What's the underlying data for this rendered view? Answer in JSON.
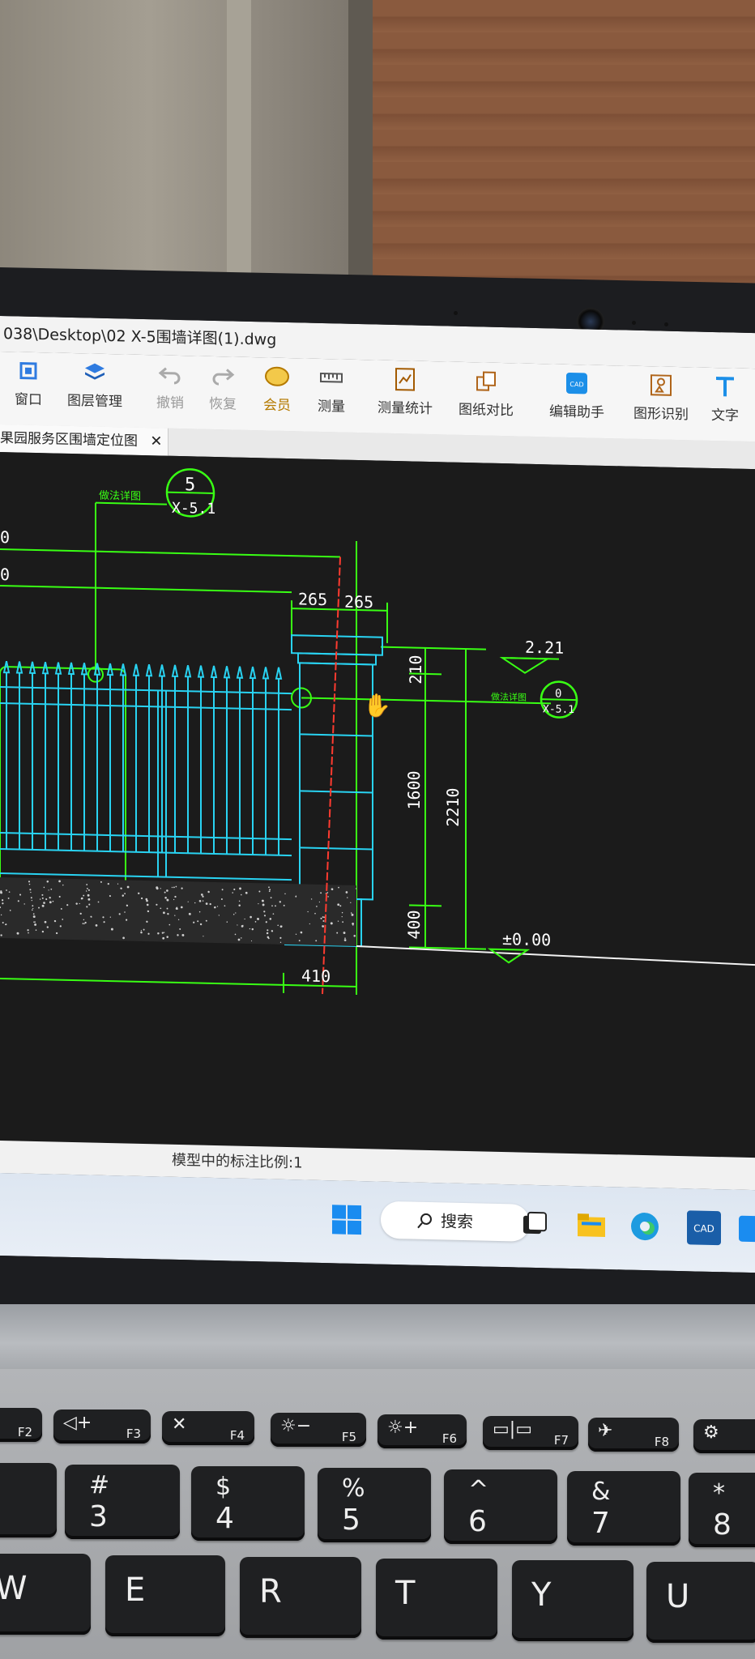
{
  "window": {
    "title": "038\\Desktop\\02 X-5围墙详图(1).dwg"
  },
  "ribbon": {
    "tools": [
      {
        "label": "窗口",
        "icon": "window-icon"
      },
      {
        "label": "图层管理",
        "icon": "layers-icon"
      },
      {
        "label": "撤销",
        "icon": "undo-icon"
      },
      {
        "label": "恢复",
        "icon": "redo-icon"
      },
      {
        "label": "会员",
        "icon": "vip-badge-icon",
        "badge": "VIP"
      },
      {
        "label": "测量",
        "icon": "measure-icon"
      },
      {
        "label": "测量统计",
        "icon": "measure-stats-icon"
      },
      {
        "label": "图纸对比",
        "icon": "compare-icon"
      },
      {
        "label": "编辑助手",
        "icon": "edit-assistant-icon"
      },
      {
        "label": "图形识别",
        "icon": "shape-recognition-icon"
      },
      {
        "label": "文字",
        "icon": "text-icon"
      }
    ]
  },
  "tabs": [
    {
      "label": "果园服务区围墙定位图"
    }
  ],
  "drawing": {
    "detail_label": "做法详图",
    "detail_number": "5",
    "detail_sheet": "X-5.1",
    "right_callout_label": "做法详图",
    "right_callout_number": "0",
    "right_callout_sheet": "X-5.1",
    "left_edge_dims": [
      "0",
      "0"
    ],
    "dim_left_half": "265",
    "dim_right_half": "265",
    "elevation_top": "2.21",
    "elevation_ground": "±0.00",
    "dim_cap": "210",
    "dim_body": "1600",
    "dim_base": "400",
    "dim_total": "2210",
    "dim_bottom": "410"
  },
  "status": {
    "text": "模型中的标注比例:1"
  },
  "taskbar": {
    "search_label": "搜索"
  },
  "keyboard": {
    "fkeys": [
      {
        "fn": "F2",
        "sym": ""
      },
      {
        "fn": "F3",
        "sym": "◁+"
      },
      {
        "fn": "F4",
        "sym": "✕"
      },
      {
        "fn": "F5",
        "sym": "☼−"
      },
      {
        "fn": "F6",
        "sym": "☼+"
      },
      {
        "fn": "F7",
        "sym": "▭|▭"
      },
      {
        "fn": "F8",
        "sym": "✈"
      },
      {
        "fn": "",
        "sym": "⚙"
      }
    ],
    "number_keys": [
      {
        "top": "#",
        "bottom": "3"
      },
      {
        "top": "$",
        "bottom": "4"
      },
      {
        "top": "%",
        "bottom": "5"
      },
      {
        "top": "^",
        "bottom": "6"
      },
      {
        "top": "&",
        "bottom": "7"
      },
      {
        "top": "*",
        "bottom": "8"
      }
    ],
    "letter_keys": [
      "W",
      "E",
      "R",
      "T",
      "Y",
      "U"
    ]
  },
  "colors": {
    "cad_green": "#39ff14",
    "cad_cyan": "#29d3f2",
    "cad_red": "#ff3b30",
    "cad_white": "#f2f2f2"
  }
}
